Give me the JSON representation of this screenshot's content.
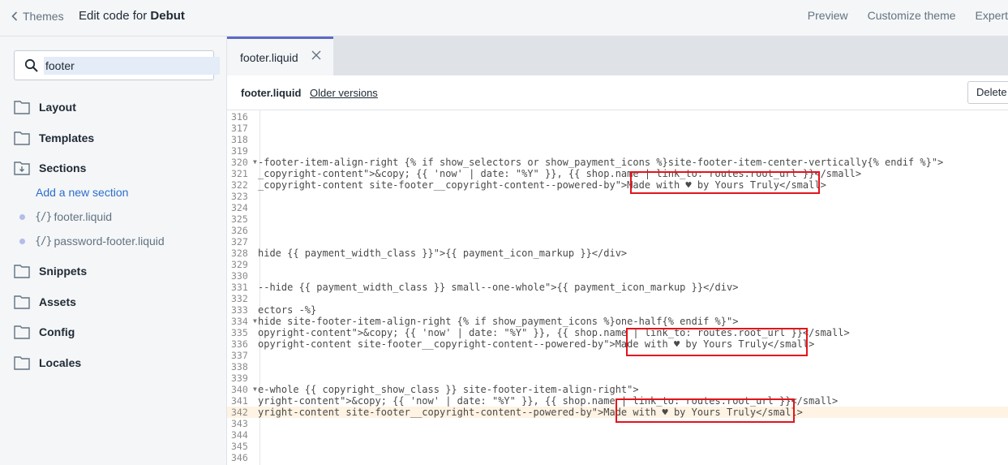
{
  "header": {
    "back_label": "Themes",
    "title_prefix": "Edit code for ",
    "theme_name": "Debut",
    "links": [
      "Preview",
      "Customize theme",
      "Expert"
    ]
  },
  "sidebar": {
    "search_value": "footer",
    "folders": [
      {
        "label": "Layout",
        "icon": "folder-icon"
      },
      {
        "label": "Templates",
        "icon": "folder-icon"
      },
      {
        "label": "Sections",
        "icon": "folder-open-download-icon"
      },
      {
        "label": "Snippets",
        "icon": "folder-icon"
      },
      {
        "label": "Assets",
        "icon": "folder-icon"
      },
      {
        "label": "Config",
        "icon": "folder-icon"
      },
      {
        "label": "Locales",
        "icon": "folder-icon"
      }
    ],
    "add_section_label": "Add a new section",
    "files": [
      {
        "icon_text": "{/}",
        "name": "footer.liquid"
      },
      {
        "icon_text": "{/}",
        "name": "password-footer.liquid"
      }
    ]
  },
  "tab": {
    "label": "footer.liquid"
  },
  "filebar": {
    "name": "footer.liquid",
    "older_versions": "Older versions",
    "delete_label": "Delete"
  },
  "code_lines": [
    {
      "n": "316",
      "t": ""
    },
    {
      "n": "317",
      "t": ""
    },
    {
      "n": "318",
      "t": ""
    },
    {
      "n": "319",
      "t": ""
    },
    {
      "n": "320",
      "fold": true,
      "t": "-footer-item-align-right {% if show_selectors or show_payment_icons %}site-footer-item-center-vertically{% endif %}\">"
    },
    {
      "n": "321",
      "t": "_copyright-content\">&copy; {{ 'now' | date: \"%Y\" }}, {{ shop.name | link_to: routes.root_url }}</small>"
    },
    {
      "n": "322",
      "t": "_copyright-content site-footer__copyright-content--powered-by\">Made with ♥ by Yours Truly</small>"
    },
    {
      "n": "323",
      "t": ""
    },
    {
      "n": "324",
      "t": ""
    },
    {
      "n": "325",
      "t": ""
    },
    {
      "n": "326",
      "t": ""
    },
    {
      "n": "327",
      "t": ""
    },
    {
      "n": "328",
      "t": "hide {{ payment_width_class }}\">{{ payment_icon_markup }}</div>"
    },
    {
      "n": "329",
      "t": ""
    },
    {
      "n": "330",
      "t": ""
    },
    {
      "n": "331",
      "t": "--hide {{ payment_width_class }} small--one-whole\">{{ payment_icon_markup }}</div>"
    },
    {
      "n": "332",
      "t": ""
    },
    {
      "n": "333",
      "t": "ectors -%}"
    },
    {
      "n": "334",
      "fold": true,
      "t": "hide site-footer-item-align-right {% if show_payment_icons %}one-half{% endif %}\">"
    },
    {
      "n": "335",
      "t": "opyright-content\">&copy; {{ 'now' | date: \"%Y\" }}, {{ shop.name | link_to: routes.root_url }}</small>"
    },
    {
      "n": "336",
      "t": "opyright-content site-footer__copyright-content--powered-by\">Made with ♥ by Yours Truly</small>"
    },
    {
      "n": "337",
      "t": ""
    },
    {
      "n": "338",
      "t": ""
    },
    {
      "n": "339",
      "t": ""
    },
    {
      "n": "340",
      "fold": true,
      "t": "e-whole {{ copyright_show_class }} site-footer-item-align-right\">"
    },
    {
      "n": "341",
      "t": "yright-content\">&copy; {{ 'now' | date: \"%Y\" }}, {{ shop.name | link_to: routes.root_url }}</small>"
    },
    {
      "n": "342",
      "hl": true,
      "t": "yright-content site-footer__copyright-content--powered-by\">Made with ♥ by Yours Truly</small>"
    },
    {
      "n": "343",
      "t": ""
    },
    {
      "n": "344",
      "t": ""
    },
    {
      "n": "345",
      "t": ""
    },
    {
      "n": "346",
      "t": ""
    }
  ],
  "colors": {
    "accent": "#5c6ac4",
    "link": "#2c6ecb",
    "highlight_box": "#e4141b",
    "active_line": "#fff3e3"
  }
}
